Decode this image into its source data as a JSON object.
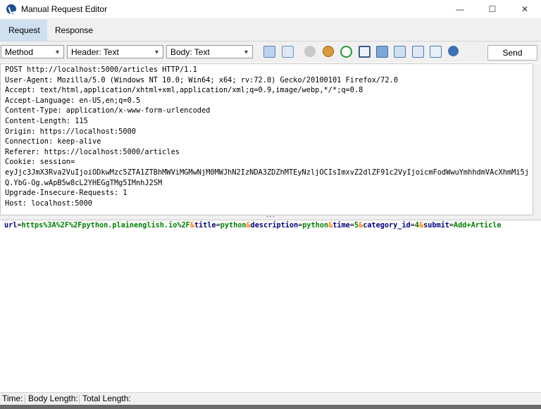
{
  "window": {
    "title": "Manual Request Editor",
    "min_glyph": "—",
    "max_glyph": "☐",
    "close_glyph": "✕"
  },
  "tabs": [
    {
      "label": "Request",
      "active": true
    },
    {
      "label": "Response",
      "active": false
    }
  ],
  "toolbar": {
    "method_label": "Method",
    "header_view_label": "Header: Text",
    "body_view_label": "Body: Text",
    "send_label": "Send",
    "icons": [
      "split-horizontal-icon",
      "split-vertical-icon",
      "record-icon",
      "cookie-icon",
      "refresh-icon",
      "fullscreen-icon",
      "chat-icon",
      "panel-icon",
      "list-view-icon",
      "table-view-icon",
      "help-icon"
    ]
  },
  "request_header": {
    "lines": [
      "POST http://localhost:5000/articles HTTP/1.1",
      "User-Agent: Mozilla/5.0 (Windows NT 10.0; Win64; x64; rv:72.0) Gecko/20100101 Firefox/72.0",
      "Accept: text/html,application/xhtml+xml,application/xml;q=0.9,image/webp,*/*;q=0.8",
      "Accept-Language: en-US,en;q=0.5",
      "Content-Type: application/x-www-form-urlencoded",
      "Content-Length: 115",
      "Origin: https://localhost:5000",
      "Connection: keep-alive",
      "Referer: https://localhost:5000/articles",
      "Cookie: session=",
      "eyJjc3JmX3Rva2VuIjoiODkwMzc5ZTA1ZTBhMWViMGMwNjM0MWJhN2IzNDA3ZDZhMTEyNzljOCIsImxvZ2dlZF91c2VyIjoicmFodWwuYmhhdmVAcXhmMi5j",
      "Q.YbG-Og.wApB5w8cL2YHEGgTMg5IMnhJ2SM",
      "Upgrade-Insecure-Requests: 1",
      "Host: localhost:5000"
    ]
  },
  "request_body": {
    "params": [
      {
        "key": "url",
        "value": "https%3A%2F%2Fpython.plainenglish.io%2F"
      },
      {
        "key": "title",
        "value": "python"
      },
      {
        "key": "description",
        "value": "python"
      },
      {
        "key": "time",
        "value": "5"
      },
      {
        "key": "category_id",
        "value": "4"
      },
      {
        "key": "submit",
        "value": "Add+Article"
      }
    ],
    "eq": "=",
    "amp": "&"
  },
  "status": {
    "time_label": "Time:",
    "body_length_label": "Body Length:",
    "total_length_label": "Total Length:"
  },
  "colors": {
    "param_key": "#000080",
    "param_value": "#008000",
    "param_amp": "#ff8000",
    "tab_active_bg": "#cfe0f0"
  }
}
